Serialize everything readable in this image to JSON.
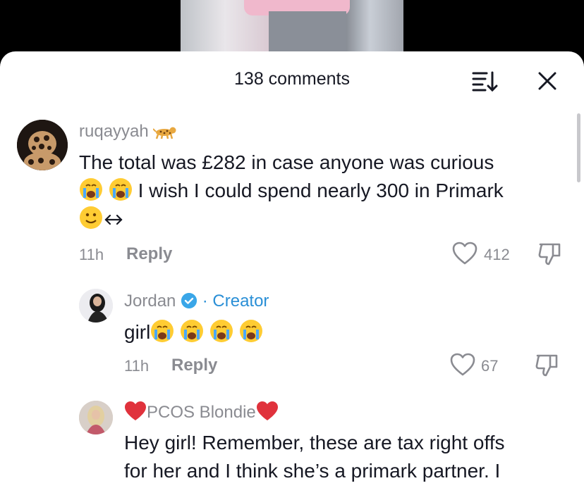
{
  "header": {
    "title": "138 comments"
  },
  "comments": [
    {
      "username": "ruqayyah",
      "text_line1": "The total was £282 in case anyone was curious",
      "text_line2": "I wish I could spend nearly 300 in Primark",
      "time": "11h",
      "reply": "Reply",
      "likes": "412"
    },
    {
      "username": "Jordan",
      "badge": "· Creator",
      "text": "girl",
      "time": "11h",
      "reply": "Reply",
      "likes": "67"
    },
    {
      "username": "PCOS Blondie",
      "text_line1": "Hey girl! Remember, these are tax right offs",
      "text_line2": "for her and I think she’s a primark partner. I"
    }
  ],
  "colors": {
    "accent": "#2a8fd6",
    "muted": "#8a8b91",
    "text": "#161823"
  }
}
